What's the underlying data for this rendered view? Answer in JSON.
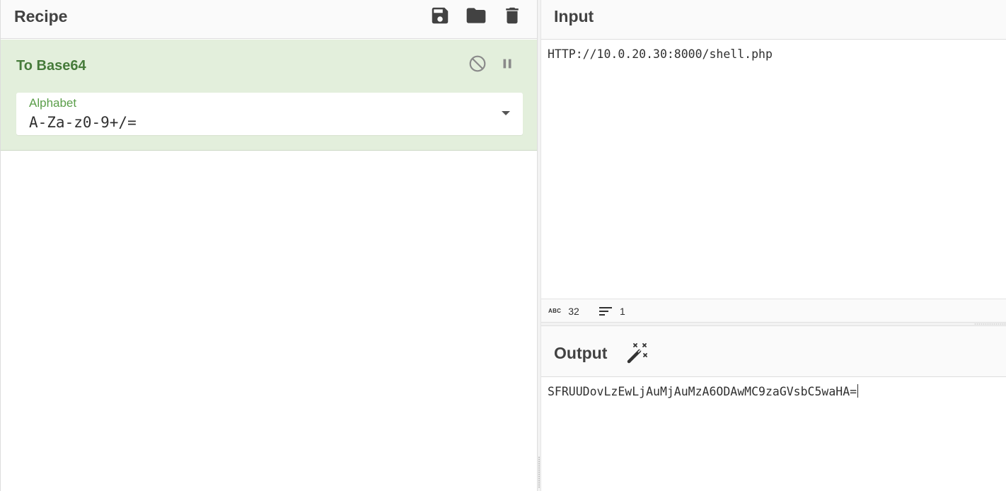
{
  "recipe": {
    "title": "Recipe",
    "buttons": [
      {
        "name": "save-recipe-button",
        "icon": "save-icon"
      },
      {
        "name": "load-recipe-button",
        "icon": "folder-icon"
      },
      {
        "name": "clear-recipe-button",
        "icon": "trash-icon"
      }
    ],
    "operation": {
      "title": "To Base64",
      "disable_icon": "disable-icon",
      "breakpoint_icon": "pause-icon",
      "argument": {
        "label": "Alphabet",
        "value": "A-Za-z0-9+/="
      }
    }
  },
  "input": {
    "title": "Input",
    "value": "HTTP://10.0.20.30:8000/shell.php",
    "stats": {
      "length_icon": "abc-icon",
      "length_label": "ABC",
      "length": "32",
      "lines_icon": "lines-icon",
      "lines": "1"
    }
  },
  "output": {
    "title": "Output",
    "magic_icon": "magic-wand-icon",
    "value": "SFRUUDovLzEwLjAuMjAuMzA6ODAwMC9zaGVsbC5waHA="
  },
  "colors": {
    "operation_bg": "#e3efdc",
    "operation_title": "#467b3a",
    "argument_label": "#5a9e49",
    "header_bg": "#fafafa"
  }
}
